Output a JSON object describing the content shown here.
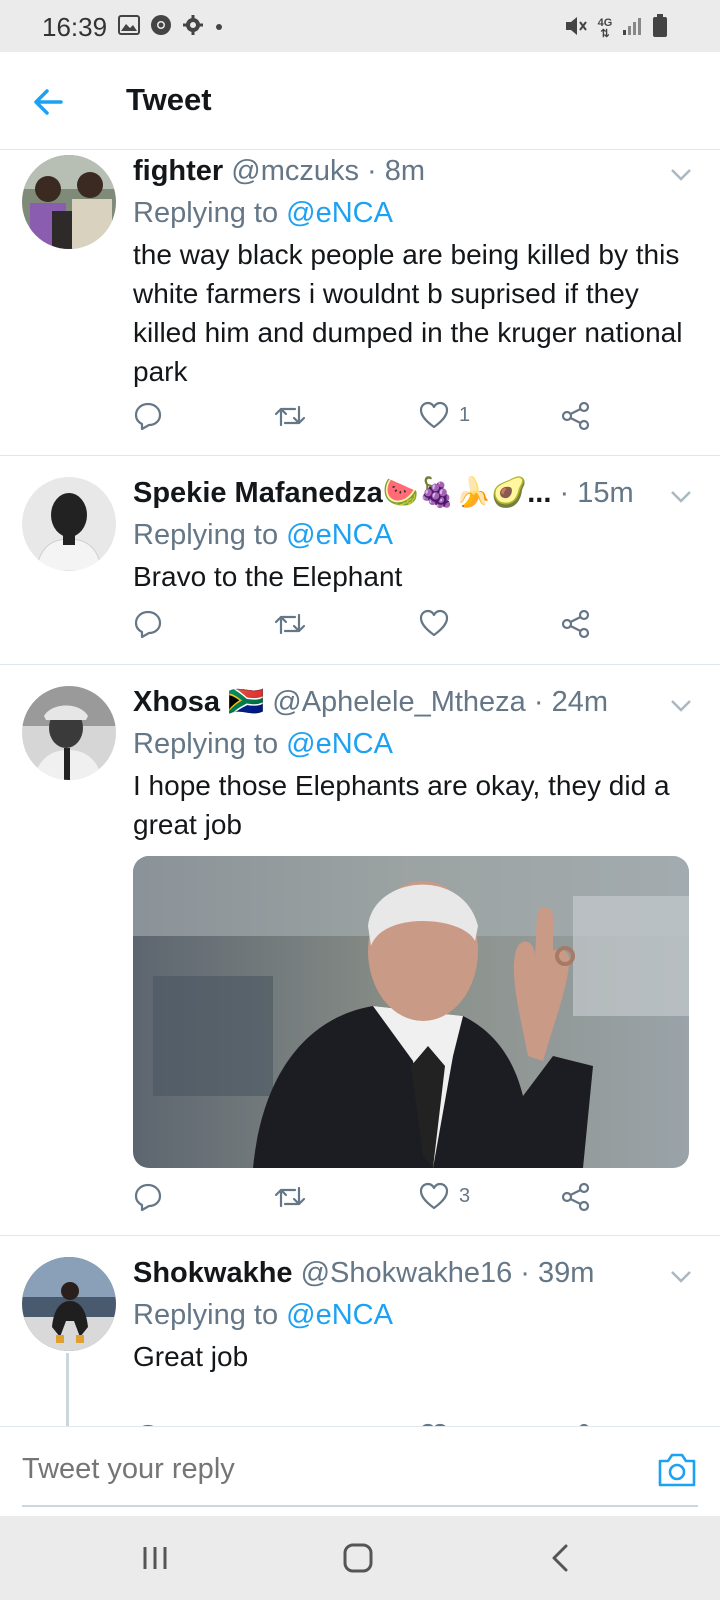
{
  "status_bar": {
    "time": "16:39",
    "left_icons": [
      "image-icon",
      "chrome-icon",
      "settings-icon",
      "dot-icon"
    ],
    "right_icons": [
      "mute-icon",
      "4g-icon",
      "signal-icon",
      "battery-icon"
    ],
    "network": "4G"
  },
  "header": {
    "title": "Tweet"
  },
  "tweets": [
    {
      "name": "fighter",
      "meta": " @mczuks · 8m",
      "replying_prefix": "Replying to ",
      "replying_to": "@eNCA",
      "text": "the way black people are being killed by this white farmers i wouldnt b suprised if they killed him and dumped in the kruger national park",
      "likes": "1"
    },
    {
      "name": "Spekie Mafanedza🍉🍇🍌🥑...",
      "meta": " · 15m",
      "replying_prefix": "Replying to ",
      "replying_to": "@eNCA",
      "text": "Bravo to the Elephant",
      "likes": ""
    },
    {
      "name": "Xhosa",
      "flag": "🇿🇦",
      "meta": " @Aphelele_Mtheza · 24m",
      "replying_prefix": "Replying to ",
      "replying_to": "@eNCA",
      "text": "I hope those Elephants are okay, they did a great job",
      "likes": "3",
      "has_media": true
    },
    {
      "name": "Shokwakhe",
      "meta": " @Shokwakhe16 · 39m",
      "replying_prefix": "Replying to ",
      "replying_to": "@eNCA",
      "text": "Great job",
      "likes": ""
    }
  ],
  "reply_bar": {
    "placeholder": "Tweet your reply"
  },
  "colors": {
    "accent": "#1da1f2",
    "secondary_text": "#657786",
    "primary_text": "#14171a",
    "divider": "#e1e8ed",
    "system_bar": "#ebebeb"
  }
}
